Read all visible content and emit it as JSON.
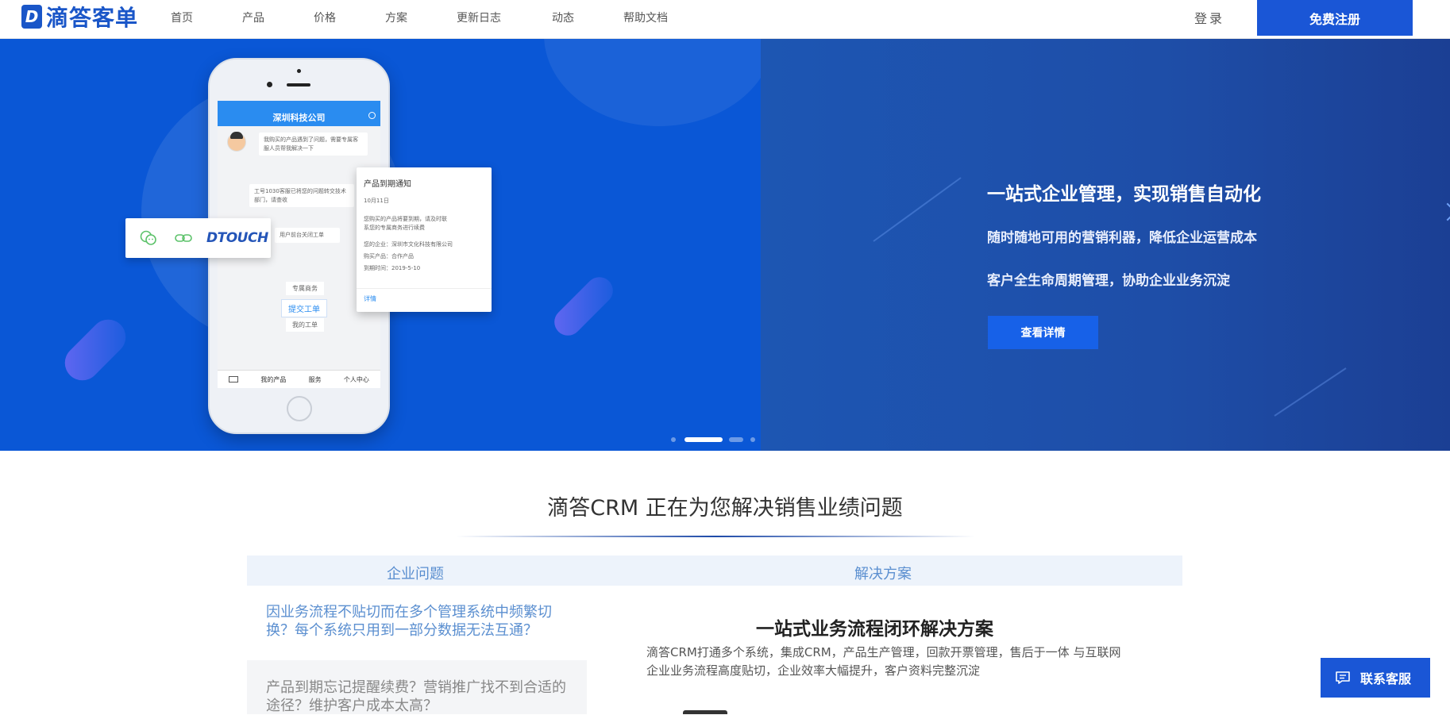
{
  "brand": {
    "logo_letter": "D",
    "name": "滴答客单",
    "color": "#1a56c8"
  },
  "nav": {
    "items": [
      {
        "label": "首页"
      },
      {
        "label": "产品"
      },
      {
        "label": "价格"
      },
      {
        "label": "方案"
      },
      {
        "label": "更新日志"
      },
      {
        "label": "动态"
      },
      {
        "label": "帮助文档"
      }
    ],
    "login_label": "登录",
    "register_label": "免费注册"
  },
  "banner": {
    "phone": {
      "title": "深圳科技公司",
      "chat_1": "我购买的产品遇到了问题，需要专属客服人员帮我解决一下",
      "chat_2": "工号1030客服已将您的问题转交技术部门，请查收",
      "chat_3": "用户前台关闭工单",
      "menu_1": "专属商务",
      "menu_2": "提交工单",
      "menu_3": "我的工单",
      "tabs": [
        "我的产品",
        "服务",
        "个人中心"
      ]
    },
    "notice": {
      "title": "产品到期通知",
      "date": "10月11日",
      "line_1": "您购买的产品将要到期，请及时联",
      "line_2": "系您的专属商务进行续费",
      "company": "您的企业：深圳市文化科技有限公司",
      "product": "购买产品：合作产品",
      "expire": "到期时间：2019-5-10",
      "link": "详情"
    },
    "share": {
      "brand": "DTOUCH"
    },
    "slogan": "一站式企业管理，实现销售自动化",
    "sub_1": "随时随地可用的营销利器，降低企业运营成本",
    "sub_2": "客户全生命周期管理，协助企业业务沉淀",
    "detail_button": "查看详情"
  },
  "section": {
    "title": "滴答CRM 正在为您解决销售业绩问题",
    "col_problem": "企业问题",
    "col_solution": "解决方案",
    "problems": [
      "因业务流程不贴切而在多个管理系统中频繁切换？每个系统只用到一部分数据无法互通？",
      "产品到期忘记提醒续费？营销推广找不到合适的途径？维护客户成本太高？"
    ],
    "solution_title": "一站式业务流程闭环解决方案",
    "solution_desc": "滴答CRM打通多个系统，集成CRM，产品生产管理，回款开票管理，售后于一体 与互联网企业业务流程高度贴切，企业效率大幅提升，客户资料完整沉淀"
  },
  "service_button": "联系客服",
  "colors": {
    "primary": "#1a56d6",
    "link_blue": "#5b8fd0"
  }
}
